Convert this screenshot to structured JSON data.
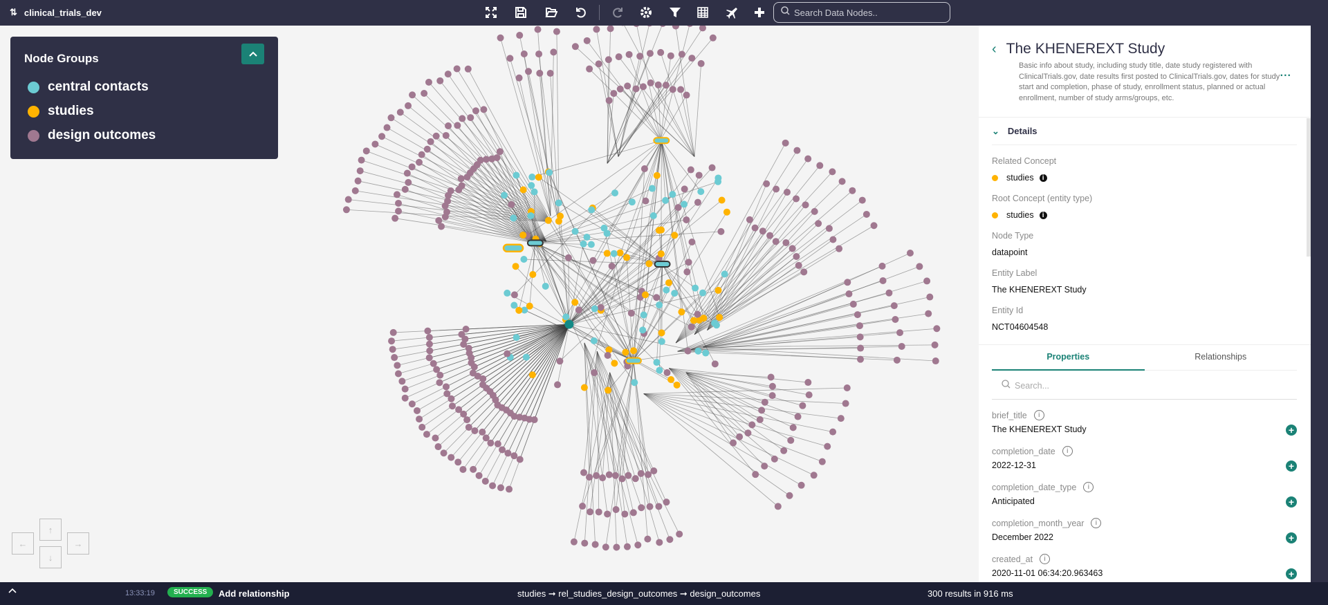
{
  "toolbar": {
    "project_name": "clinical_trials_dev",
    "search_placeholder": "Search Data Nodes..",
    "icons": [
      "sync-icon",
      "fullscreen-icon",
      "save-icon",
      "folder-open-icon",
      "undo-icon",
      "redo-icon",
      "gear-icon",
      "filter-icon",
      "table-icon",
      "plane-icon",
      "plus-icon",
      "search-icon"
    ]
  },
  "legend": {
    "title": "Node Groups",
    "groups": [
      {
        "label": "central contacts",
        "color": "#6ccbd3"
      },
      {
        "label": "studies",
        "color": "#ffb300"
      },
      {
        "label": "design outcomes",
        "color": "#a07890"
      }
    ]
  },
  "nav": {
    "up": "↑",
    "down": "↓",
    "left": "←",
    "right": "→"
  },
  "panel": {
    "title": "The KHENEREXT Study",
    "description": "Basic info about study, including study title, date study registered with ClinicalTrials.gov, date results first posted to ClinicalTrials.gov, dates for study start and completion, phase of study, enrollment status, planned or actual enrollment, number of study arms/groups, etc.",
    "more": "...",
    "details_label": "Details",
    "related_concept_label": "Related Concept",
    "related_concept": "studies",
    "root_concept_label": "Root Concept (entity type)",
    "root_concept": "studies",
    "node_type_label": "Node Type",
    "node_type": "datapoint",
    "entity_label_label": "Entity Label",
    "entity_label": "The KHENEREXT Study",
    "entity_id_label": "Entity Id",
    "entity_id": "NCT04604548",
    "tabs": [
      "Properties",
      "Relationships"
    ],
    "search_placeholder": "Search...",
    "properties": [
      {
        "key": "brief_title",
        "value": "The KHENEREXT Study"
      },
      {
        "key": "completion_date",
        "value": "2022-12-31"
      },
      {
        "key": "completion_date_type",
        "value": "Anticipated"
      },
      {
        "key": "completion_month_year",
        "value": "December 2022"
      },
      {
        "key": "created_at",
        "value": "2020-11-01 06:34:20.963463"
      }
    ]
  },
  "status": {
    "time": "13:33:19",
    "badge": "SUCCESS",
    "action": "Add relationship",
    "path": "studies ➞ rel_studies_design_outcomes ➞ design_outcomes",
    "results": "300 results in 916 ms"
  }
}
